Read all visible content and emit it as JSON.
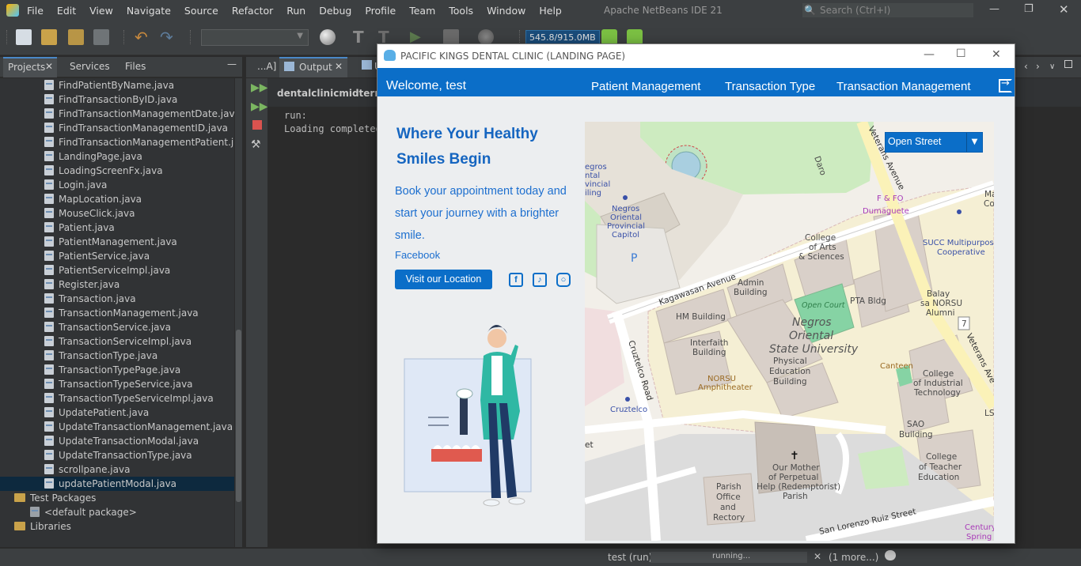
{
  "ide": {
    "window_title": "Apache NetBeans IDE 21",
    "menu": [
      "File",
      "Edit",
      "View",
      "Navigate",
      "Source",
      "Refactor",
      "Run",
      "Debug",
      "Profile",
      "Team",
      "Tools",
      "Window",
      "Help"
    ],
    "search_placeholder": "Search (Ctrl+I)",
    "memory": "545.8/915.0MB"
  },
  "projects_panel": {
    "tabs": [
      "Projects",
      "Services",
      "Files"
    ],
    "files": [
      "FindPatientByName.java",
      "FindTransactionByID.java",
      "FindTransactionManagementDate.java",
      "FindTransactionManagementID.java",
      "FindTransactionManagementPatient.java",
      "LandingPage.java",
      "LoadingScreenFx.java",
      "Login.java",
      "MapLocation.java",
      "MouseClick.java",
      "Patient.java",
      "PatientManagement.java",
      "PatientService.java",
      "PatientServiceImpl.java",
      "Register.java",
      "Transaction.java",
      "TransactionManagement.java",
      "TransactionService.java",
      "TransactionServiceImpl.java",
      "TransactionType.java",
      "TransactionTypePage.java",
      "TransactionTypeService.java",
      "TransactionTypeServiceImpl.java",
      "UpdatePatient.java",
      "UpdateTransactionManagement.java",
      "UpdateTransactionModal.java",
      "UpdateTransactionType.java",
      "scrollpane.java",
      "updatePatientModal.java"
    ],
    "selected_file": "updatePatientModal.java",
    "test_packages": "Test Packages",
    "default_package": "<default package>",
    "libraries": "Libraries"
  },
  "output_panel": {
    "tabs": [
      "...A]",
      "Output",
      "U"
    ],
    "project_heading": "dentalclinicmidterm (r",
    "lines": [
      "run:",
      "Loading completed"
    ]
  },
  "status": {
    "run_label": "test (run)",
    "progress_text": "running...",
    "more": "(1 more...)"
  },
  "dialog": {
    "title": "PACIFIC KINGS DENTAL CLINIC (LANDING PAGE)",
    "welcome": "Welcome,  test",
    "nav": [
      "Patient Management",
      "Transaction Type",
      "Transaction Management"
    ],
    "heading": "Where Your Healthy Smiles Begin",
    "subtext": "Book your appointment today and start your journey with a brighter smile.",
    "facebook_link": "Facebook",
    "visit_button": "Visit our Location",
    "map_style": "Open Street",
    "map_labels": {
      "veterans": "Veterans Avenue",
      "veterans2": "Veterans Ave",
      "kagawasan": "Kagawasan Avenue",
      "cruztelco_road": "Cruztelco Road",
      "san_lorenzo": "San Lorenzo Ruiz Street",
      "capitol": [
        "Negros",
        "Oriental",
        "Provincial",
        "Capitol"
      ],
      "negros_left": [
        "egros",
        "ntal",
        "vincial",
        "iling"
      ],
      "college_arts": [
        "College",
        "of Arts",
        "& Sciences"
      ],
      "admin": [
        "Admin",
        "Building"
      ],
      "open_court": "Open Court",
      "pta": "PTA Bldg",
      "hm": "HM Building",
      "interfaith": [
        "Interfaith",
        "Building"
      ],
      "norsu_amph": [
        "NORSU",
        "Amphitheater"
      ],
      "nosu": [
        "Negros",
        "Oriental",
        "State University"
      ],
      "phys_ed": [
        "Physical",
        "Education",
        "Building"
      ],
      "canteen": "Canteen",
      "balay": [
        "Balay",
        "sa NORSU",
        "Alumni"
      ],
      "cit": [
        "College",
        "of Industrial",
        "Technology"
      ],
      "sao": [
        "SAO",
        "Building"
      ],
      "cte": [
        "College",
        "of Teacher",
        "Education"
      ],
      "cruztelco": "Cruztelco",
      "parish": [
        "Our Mother",
        "of Perpetual",
        "Help (Redemptorist)",
        "Parish"
      ],
      "parish_office": [
        "Parish",
        "Office",
        "and",
        "Rectory"
      ],
      "succ": [
        "SUCC Multipurpose",
        "Cooperative"
      ],
      "ffo": [
        "F & FO",
        "Dumaguete"
      ],
      "century": [
        "Century",
        "Spring"
      ],
      "daro": "Daro",
      "parking": "P",
      "route": "7",
      "edge_ma": [
        "Ma",
        "Co"
      ],
      "edge_ls": "LS",
      "edge_et": "et"
    }
  }
}
